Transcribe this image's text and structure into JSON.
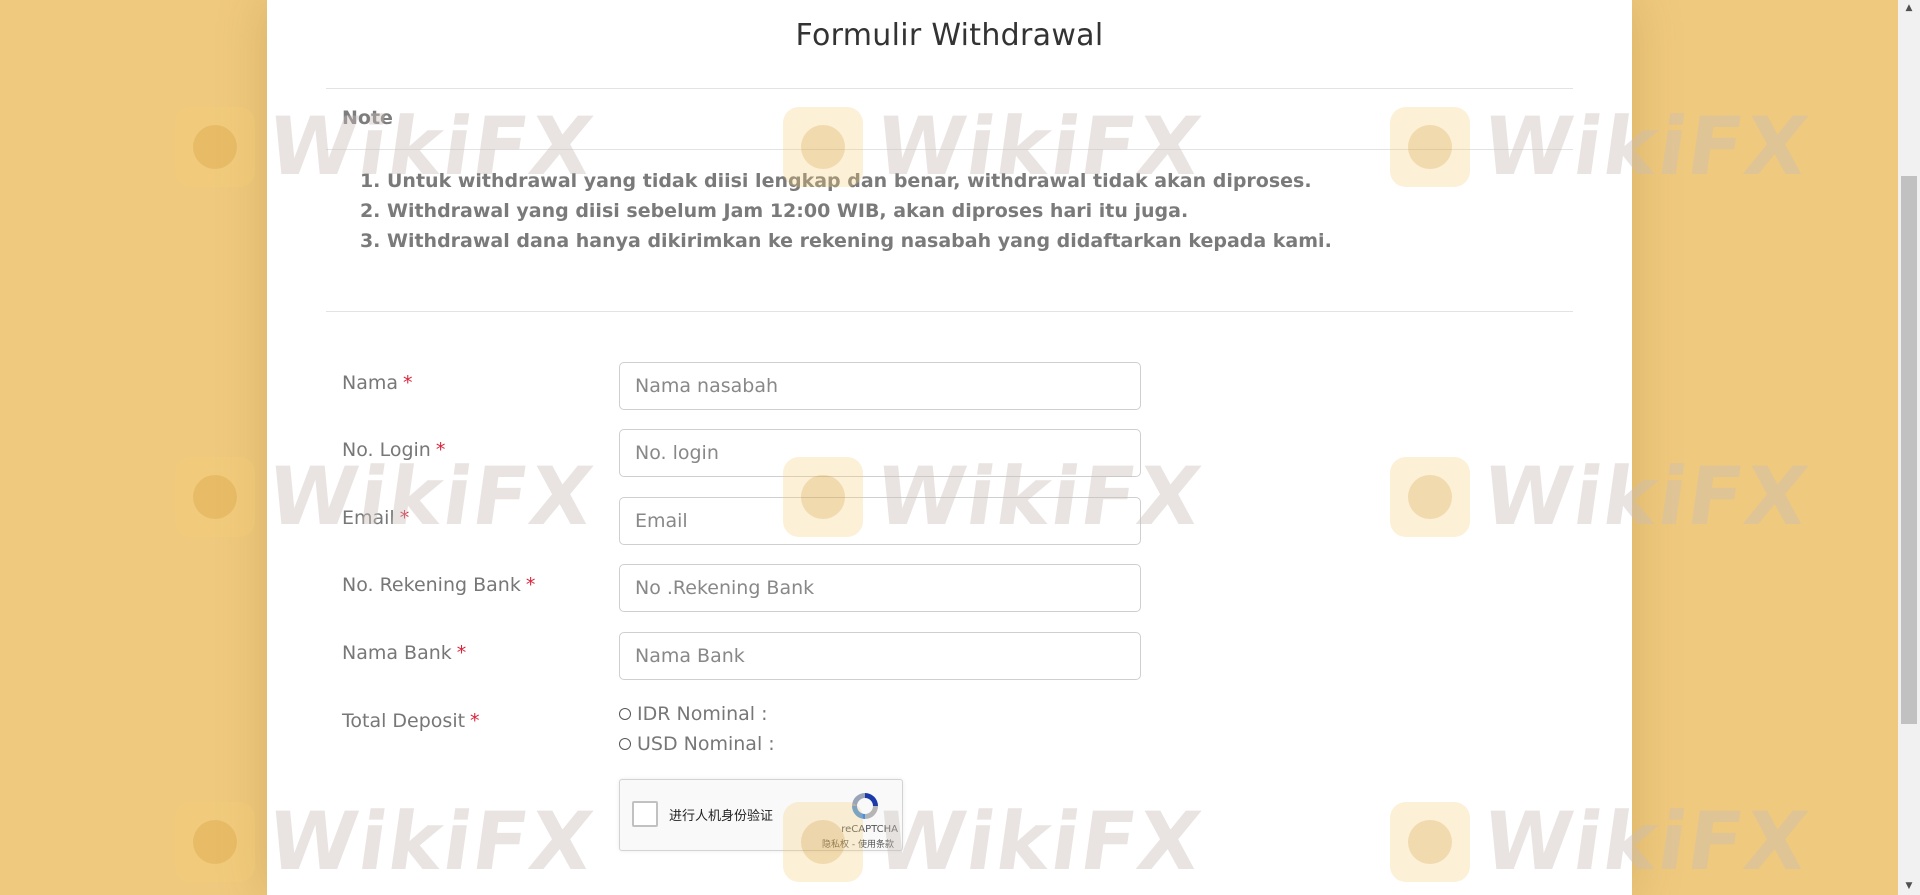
{
  "form": {
    "title": "Formulir Withdrawal",
    "note_title": "Note",
    "notes": [
      "Untuk withdrawal yang tidak diisi lengkap dan benar, withdrawal tidak akan diproses.",
      "Withdrawal yang diisi sebelum Jam 12:00 WIB, akan diproses hari itu juga.",
      "Withdrawal dana hanya dikirimkan ke rekening nasabah yang didaftarkan kepada kami."
    ],
    "required_mark": "*",
    "fields": {
      "nama": {
        "label": "Nama",
        "placeholder": "Nama nasabah"
      },
      "login": {
        "label": "No. Login",
        "placeholder": "No. login"
      },
      "email": {
        "label": "Email",
        "placeholder": "Email"
      },
      "rekening": {
        "label": "No. Rekening Bank",
        "placeholder": "No .Rekening Bank"
      },
      "bank": {
        "label": "Nama Bank",
        "placeholder": "Nama Bank"
      }
    },
    "deposit": {
      "label": "Total Deposit",
      "options": [
        "IDR Nominal :",
        "USD Nominal :"
      ]
    },
    "captcha": {
      "text": "进行人机身份验证",
      "brand": "reCAPTCHA",
      "links": "隐私权 - 使用条款"
    }
  },
  "watermark": {
    "text": "WikiFX"
  },
  "colors": {
    "page_background": "#efc97e",
    "card_background": "#ffffff",
    "required": "#d9243b"
  },
  "icons": {
    "scroll_up": "triangle-up",
    "scroll_down": "triangle-down",
    "captcha_logo": "recaptcha-icon"
  }
}
